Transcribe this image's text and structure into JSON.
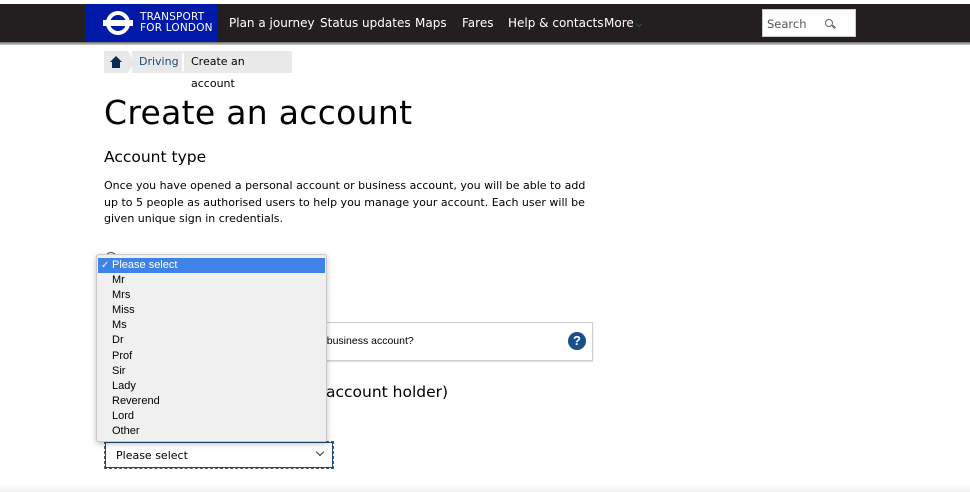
{
  "brand": {
    "logo_line1": "TRANSPORT",
    "logo_line2": "FOR LONDON",
    "color": "#0019a8"
  },
  "nav": {
    "items": [
      "Plan a journey",
      "Status updates",
      "Maps",
      "Fares",
      "Help & contacts",
      "More"
    ],
    "search_placeholder": "Search"
  },
  "breadcrumb": {
    "home_icon": "home-icon",
    "link": "Driving",
    "current": "Create an account"
  },
  "page": {
    "title": "Create an account",
    "section_heading": "Account type",
    "intro": "Once you have opened a personal account or business account, you will be able to add up to 5 people as authorised users to help you manage your account. Each user will be given unique sign in credentials.",
    "info_text": "d business account?",
    "help_icon": "?",
    "holder_heading": "account holder)"
  },
  "title_select": {
    "value": "Please select",
    "options": [
      "Please select",
      "Mr",
      "Mrs",
      "Miss",
      "Ms",
      "Dr",
      "Prof",
      "Sir",
      "Lady",
      "Reverend",
      "Lord",
      "Other"
    ],
    "selected_index": 0,
    "check_mark": "✓"
  }
}
